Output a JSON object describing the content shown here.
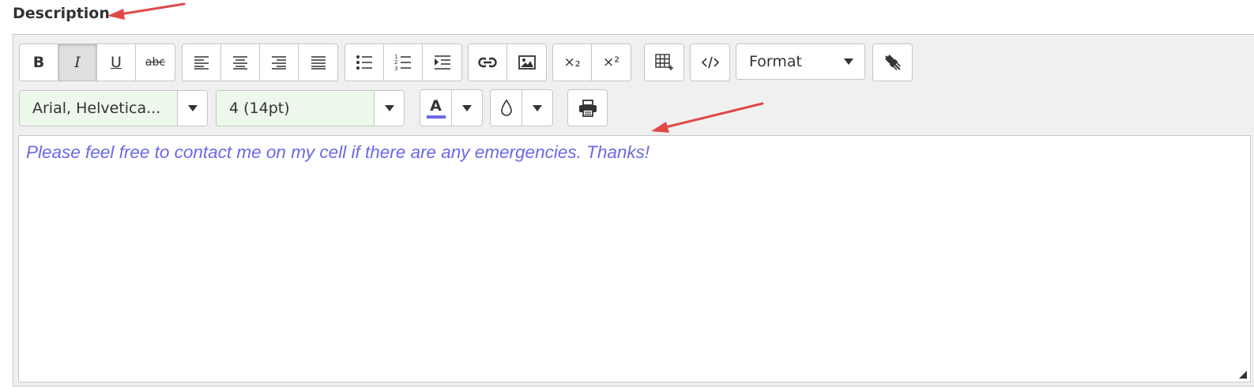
{
  "field": {
    "label": "Description"
  },
  "toolbar": {
    "row1": {
      "text_style": [
        {
          "name": "bold",
          "label": "B"
        },
        {
          "name": "italic",
          "label": "I"
        },
        {
          "name": "underline",
          "label": "U"
        },
        {
          "name": "strikethrough",
          "label": "abc"
        }
      ],
      "alignment": [
        "align-left",
        "align-center",
        "align-right",
        "align-justify"
      ],
      "lists": [
        "bullet-list",
        "numbered-list",
        "indent"
      ],
      "insert": [
        "link",
        "image"
      ],
      "script": [
        {
          "name": "subscript",
          "label": "×₂"
        },
        {
          "name": "superscript",
          "label": "×²"
        }
      ],
      "format_label": "Format"
    },
    "row2": {
      "font_family": "Arial, Helvetica...",
      "font_size": "4 (14pt)",
      "font_color_label": "A"
    }
  },
  "content": {
    "text": "Please feel free to contact me on my cell if there are any emergencies. Thanks!"
  },
  "colors": {
    "text_color": "#6b68e8",
    "annotation_arrow": "#e04848",
    "font_color_bar": "#6b68e8",
    "select_bg": "#ecf8ea"
  }
}
